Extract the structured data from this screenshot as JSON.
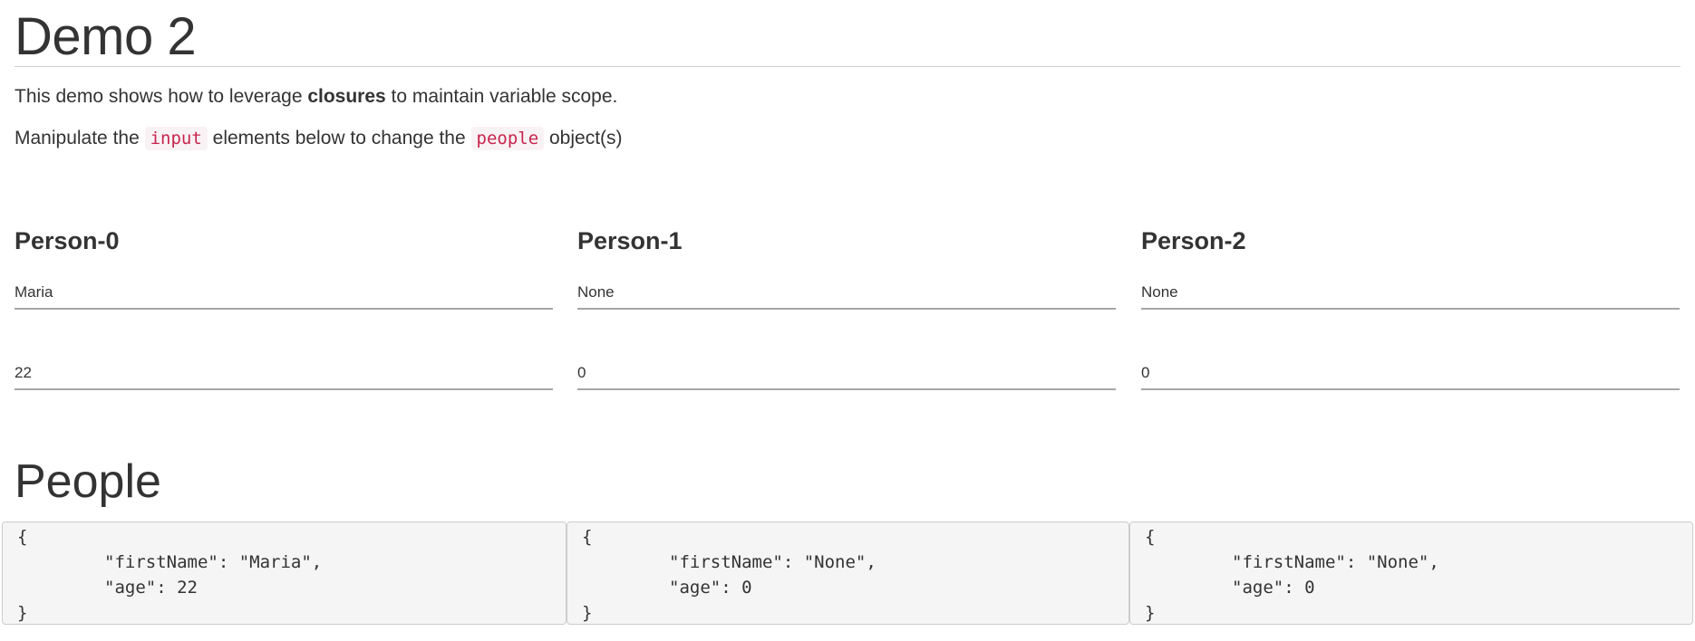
{
  "page": {
    "title": "Demo 2",
    "intro": {
      "before": "This demo shows how to leverage ",
      "bold": "closures",
      "after": " to maintain variable scope."
    },
    "instructions": {
      "before": "Manipulate the ",
      "code1": "input",
      "middle": " elements below to change the ",
      "code2": "people",
      "after": " object(s)"
    }
  },
  "persons": [
    {
      "heading": "Person-0",
      "name_value": "Maria",
      "age_value": "22"
    },
    {
      "heading": "Person-1",
      "name_value": "None",
      "age_value": "0"
    },
    {
      "heading": "Person-2",
      "name_value": "None",
      "age_value": "0"
    }
  ],
  "people_section": {
    "title": "People",
    "objects": [
      {
        "open": "{",
        "first_name_line": "\"firstName\": \"Maria\",",
        "age_line": "\"age\": 22",
        "close": "}"
      },
      {
        "open": "{",
        "first_name_line": "\"firstName\": \"None\",",
        "age_line": "\"age\": 0",
        "close": "}"
      },
      {
        "open": "{",
        "first_name_line": "\"firstName\": \"None\",",
        "age_line": "\"age\": 0",
        "close": "}"
      }
    ]
  }
}
